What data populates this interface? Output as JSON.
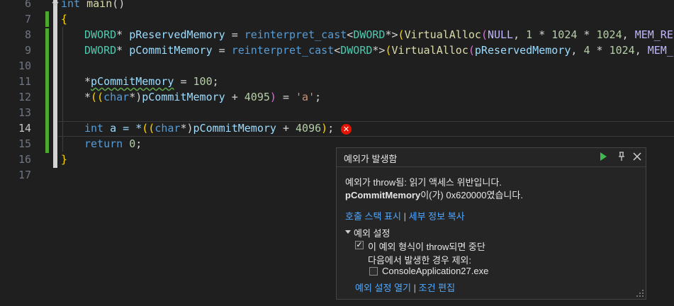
{
  "editor": {
    "line_numbers": [
      "6",
      "7",
      "8",
      "9",
      "10",
      "11",
      "12",
      "13",
      "14",
      "15",
      "16",
      "17"
    ],
    "current_line": "14"
  },
  "code": {
    "l6_kw": "int",
    "l6_fn": "main",
    "l6_p": "()",
    "l7": "{",
    "l8_ty": "DWORD",
    "l8_star": "* ",
    "l8_var": "pReservedMemory",
    "l8_eq": " = ",
    "l8_cast": "reinterpret_cast",
    "l8_lt": "<",
    "l8_ty2": "DWORD",
    "l8_gt": "*>",
    "l8_p": "(",
    "l8_fn": "VirtualAlloc",
    "l8_p2": "(",
    "l8_null": "NULL",
    "l8_c": ", ",
    "l8_n1": "1",
    "l8_m": " * ",
    "l8_n2": "1024",
    "l8_m2": " * ",
    "l8_n3": "1024",
    "l8_c2": ", ",
    "l8_mac": "MEM_RESER",
    "l9_ty": "DWORD",
    "l9_star": "* ",
    "l9_var": "pCommitMemory",
    "l9_eq": " = ",
    "l9_cast": "reinterpret_cast",
    "l9_lt": "<",
    "l9_ty2": "DWORD",
    "l9_gt": "*>",
    "l9_p": "(",
    "l9_fn": "VirtualAlloc",
    "l9_p2": "(",
    "l9_arg": "pReservedMemory",
    "l9_c": ", ",
    "l9_n1": "4",
    "l9_m": " * ",
    "l9_n2": "1024",
    "l9_c2": ", ",
    "l9_mac": "MEM_CON",
    "l11_star": "*",
    "l11_var": "pCommitMemory",
    "l11_eq": " = ",
    "l11_n": "100",
    "l11_semi": ";",
    "l12_star": "*",
    "l12_p1": "((",
    "l12_kw": "char",
    "l12_st": "*)",
    "l12_var": "pCommitMemory",
    "l12_plus": " + ",
    "l12_n": "4095",
    "l12_p2": ")",
    "l12_eq": " = ",
    "l12_str": "'a'",
    "l12_semi": ";",
    "l14_kw": "int",
    "l14_a": " a = *",
    "l14_p1": "((",
    "l14_kw2": "char",
    "l14_st": "*)",
    "l14_var": "pCommitMemory",
    "l14_plus": " + ",
    "l14_n": "4096",
    "l14_p2": ")",
    "l14_semi": ";",
    "l15_kw": "return",
    "l15_n": "0",
    "l15_semi": ";",
    "l16": "}"
  },
  "exception_popup": {
    "title": "예외가 발생함",
    "message_line1": "예외가 throw됨: 읽기 액세스 위반입니다.",
    "message_var": "pCommitMemory",
    "message_line2_rest": "이(가) 0x620000였습니다.",
    "link_call_stack": "호출 스택 표시",
    "link_separator": "|",
    "link_copy_details": "세부 정보 복사",
    "settings_header": "예외 설정",
    "break_option": "이 예외 형식이 throw되면 중단",
    "break_option_checked": true,
    "except_label": "다음에서 발생한 경우 제외:",
    "except_item": "ConsoleApplication27.exe",
    "except_item_checked": false,
    "link_open_settings": "예외 설정 열기",
    "link_edit_conditions": "조건 편집"
  },
  "icons": {
    "continue": "play-icon",
    "pin": "pin-icon",
    "close": "close-icon",
    "error": "error-icon",
    "collapse": "collapse-triangle-icon",
    "checkbox": "checkbox-icon",
    "resize": "resize-grip-icon",
    "fold": "fold-chevron-icon"
  },
  "colors": {
    "background": "#1f1f1f",
    "change_bar": "#4ea72e",
    "error": "#e51400",
    "link": "#4fa8ff",
    "continue_green": "#3fb950"
  }
}
